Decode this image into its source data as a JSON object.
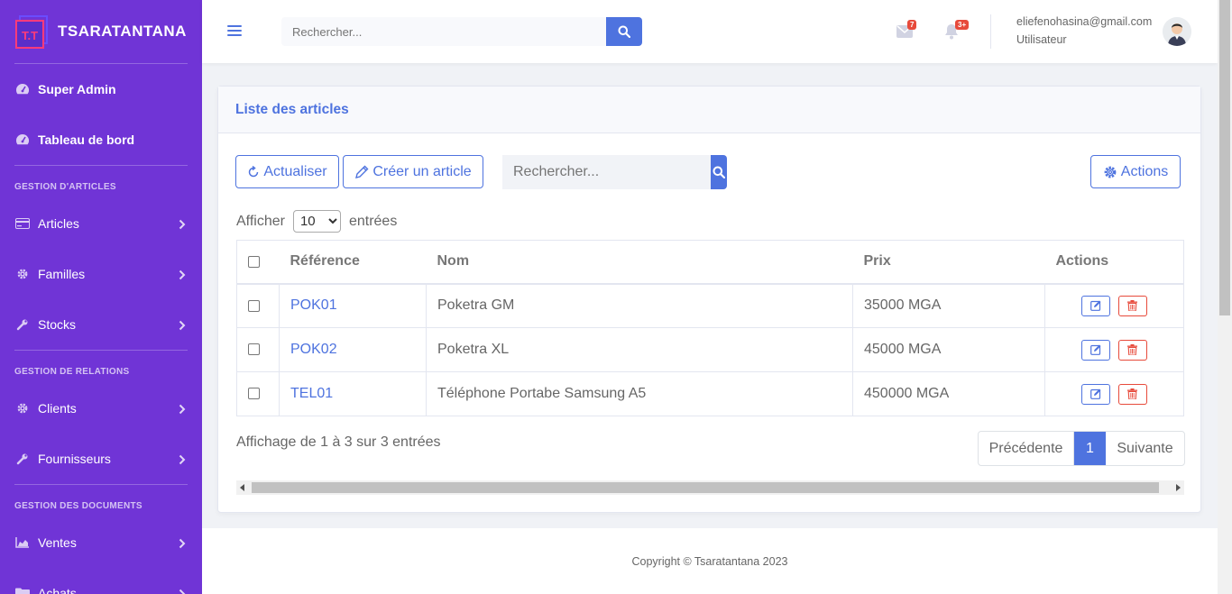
{
  "brand": {
    "name": "TSARATANTANA",
    "logo_text": "T.T"
  },
  "sidebar": {
    "top_items": [
      {
        "label": "Super Admin"
      },
      {
        "label": "Tableau de bord"
      }
    ],
    "sections": [
      {
        "heading": "GESTION D'ARTICLES",
        "items": [
          {
            "label": "Articles"
          },
          {
            "label": "Familles"
          },
          {
            "label": "Stocks"
          }
        ]
      },
      {
        "heading": "GESTION DE RELATIONS",
        "items": [
          {
            "label": "Clients"
          },
          {
            "label": "Fournisseurs"
          }
        ]
      },
      {
        "heading": "GESTION DES DOCUMENTS",
        "items": [
          {
            "label": "Ventes"
          },
          {
            "label": "Achats"
          }
        ]
      }
    ]
  },
  "topbar": {
    "search_placeholder": "Rechercher...",
    "messages_badge": "7",
    "alerts_badge": "3+",
    "user_email": "eliefenohasina@gmail.com",
    "user_role": "Utilisateur"
  },
  "card": {
    "title": "Liste des articles",
    "refresh_label": "Actualiser",
    "create_label": "Créer un article",
    "search_placeholder": "Rechercher...",
    "actions_label": "Actions",
    "length_prefix": "Afficher",
    "length_value": "10",
    "length_suffix": "entrées",
    "columns": {
      "ref": "Référence",
      "name": "Nom",
      "price": "Prix",
      "actions": "Actions"
    },
    "rows": [
      {
        "ref": "POK01",
        "name": "Poketra GM",
        "price": "35000 MGA"
      },
      {
        "ref": "POK02",
        "name": "Poketra XL",
        "price": "45000 MGA"
      },
      {
        "ref": "TEL01",
        "name": "Téléphone Portabe Samsung A5",
        "price": "450000 MGA"
      }
    ],
    "info": "Affichage de 1 à 3 sur 3 entrées",
    "pager": {
      "prev": "Précédente",
      "current": "1",
      "next": "Suivante"
    }
  },
  "footer": {
    "text": "Copyright © Tsaratantana 2023"
  },
  "colors": {
    "sidebar": "#7034d6",
    "primary": "#4e73df",
    "danger": "#e74a3b"
  }
}
